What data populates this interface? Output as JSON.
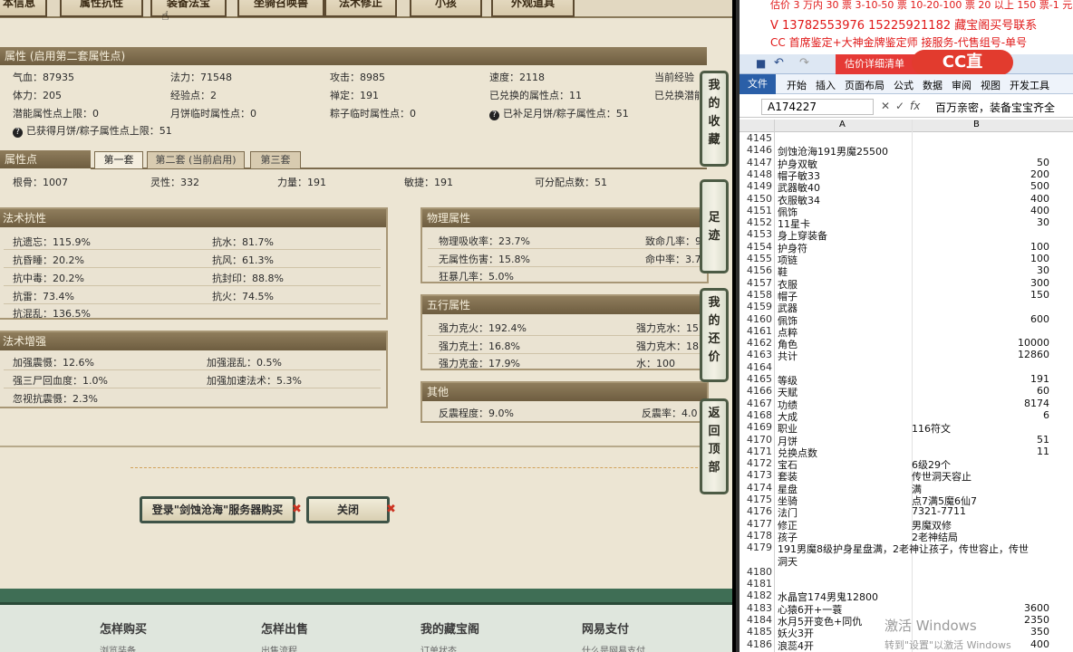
{
  "game": {
    "tabs": [
      "本信息",
      "属性抗性",
      "装备法宝",
      "坐骑召唤兽",
      "法术修正",
      "小孩",
      "外观道具"
    ],
    "attr_section_title": "属性 (启用第二套属性点)",
    "attr_rows": [
      [
        "气血：87935",
        "法力：71548",
        "攻击：8985",
        "速度：2118",
        "当前经验"
      ],
      [
        "体力：205",
        "经验点：2",
        "禅定：191",
        "已兑换的属性点：11",
        "已兑换潜能"
      ],
      [
        "潜能属性点上限：0",
        "月饼临时属性点：0",
        "粽子临时属性点：0",
        "已补足月饼/粽子属性点：51",
        ""
      ],
      [
        "已获得月饼/粽子属性点上限：51",
        "",
        "",
        "",
        ""
      ]
    ],
    "points_title": "属性点",
    "point_tabs": [
      "第一套",
      "第二套 (当前启用)",
      "第三套"
    ],
    "points_row": [
      "根骨：1007",
      "灵性：332",
      "力量：191",
      "敏捷：191",
      "可分配点数：51"
    ],
    "resist_title": "法术抗性",
    "resist_items": [
      [
        "抗遗忘：115.9%",
        "抗水：81.7%"
      ],
      [
        "抗昏睡：20.2%",
        "抗风：61.3%"
      ],
      [
        "抗中毒：20.2%",
        "抗封印：88.8%"
      ],
      [
        "抗雷：73.4%",
        "抗火：74.5%"
      ],
      [
        "抗混乱：136.5%",
        ""
      ]
    ],
    "enhance_title": "法术增强",
    "enhance_items": [
      [
        "加强震慑：12.6%",
        "加强混乱：0.5%"
      ],
      [
        "强三尸回血度：1.0%",
        "加强加速法术：5.3%"
      ],
      [
        "忽视抗震慑：2.3%",
        ""
      ]
    ],
    "phys_title": "物理属性",
    "phys_items": [
      [
        "物理吸收率：23.7%",
        "致命几率：9"
      ],
      [
        "无属性伤害：15.8%",
        "命中率：3.7"
      ],
      [
        "狂暴几率：5.0%",
        ""
      ]
    ],
    "wuxing_title": "五行属性",
    "wuxing_items": [
      [
        "强力克火：192.4%",
        "强力克水：15"
      ],
      [
        "强力克土：16.8%",
        "强力克木：18"
      ],
      [
        "强力克金：17.9%",
        "水：100"
      ]
    ],
    "other_title": "其他",
    "other_items": [
      "反震程度：9.0%",
      "反震率：4.0"
    ],
    "side_tabs": [
      "我的收藏",
      "足迹",
      "我的还价",
      "返回顶部"
    ],
    "buy_button": "登录\"剑蚀沧海\"服务器购买",
    "close_button": "关闭",
    "footer": [
      "怎样购买",
      "怎样出售",
      "我的藏宝阁",
      "网易支付"
    ],
    "footer_sub": [
      "浏览装备",
      "出售流程",
      "订单状态",
      "什么是网易支付"
    ]
  },
  "excel": {
    "ad_lines": [
      "估价 3 万内 30 票  3-10-50 票  10-20-100 票  20 以上 150 票-1 元",
      "V 13782553976   15225921182  藏宝阁买号联系",
      "CC 首席鉴定+大神金牌鉴定师 接服务-代售组号-单号"
    ],
    "window_title": "估价详细清单",
    "logo": "CC直",
    "ribbon_tabs": [
      "文件",
      "开始",
      "插入",
      "页面布局",
      "公式",
      "数据",
      "审阅",
      "视图",
      "开发工具"
    ],
    "name_box": "A174227",
    "formula_symbols": "fx",
    "formula": "百万亲密，装备宝宝齐全",
    "col_a": "A",
    "col_b": "B",
    "rows": [
      [
        "4145",
        "",
        ""
      ],
      [
        "4146",
        "剑蚀沧海191男魔25500",
        ""
      ],
      [
        "4147",
        "护身双敏",
        "50"
      ],
      [
        "4148",
        "帽子敏33",
        "200"
      ],
      [
        "4149",
        "武器敏40",
        "500"
      ],
      [
        "4150",
        "衣服敏34",
        "400"
      ],
      [
        "4151",
        "佩饰",
        "400"
      ],
      [
        "4152",
        "11星卡",
        "30"
      ],
      [
        "4153",
        "身上穿装备",
        ""
      ],
      [
        "4154",
        "护身符",
        "100"
      ],
      [
        "4155",
        "项链",
        "100"
      ],
      [
        "4156",
        "鞋",
        "30"
      ],
      [
        "4157",
        "衣服",
        "300"
      ],
      [
        "4158",
        "帽子",
        "150"
      ],
      [
        "4159",
        "武器",
        ""
      ],
      [
        "4160",
        "佩饰",
        "600"
      ],
      [
        "4161",
        "点粹",
        ""
      ],
      [
        "4162",
        "角色",
        "10000"
      ],
      [
        "4163",
        "共计",
        "12860"
      ],
      [
        "4164",
        "",
        ""
      ],
      [
        "4165",
        "等级",
        "191"
      ],
      [
        "4166",
        "天赋",
        "60"
      ],
      [
        "4167",
        "功绩",
        "8174"
      ],
      [
        "4168",
        "大成",
        "6"
      ],
      [
        "4169",
        "职业",
        "116符文"
      ],
      [
        "4170",
        "月饼",
        "51"
      ],
      [
        "4171",
        "兑换点数",
        "11"
      ],
      [
        "4172",
        "宝石",
        "6级29个"
      ],
      [
        "4173",
        "套装",
        "传世洞天容止"
      ],
      [
        "4174",
        "星盘",
        "满"
      ],
      [
        "4175",
        "坐骑",
        "点7满5魔6仙7"
      ],
      [
        "4176",
        "法门",
        "7321-7711"
      ],
      [
        "4177",
        "修正",
        "男魔双修"
      ],
      [
        "4178",
        "孩子",
        "2老神结局"
      ],
      [
        "4179",
        "191男魔8级护身星盘满，2老神让孩子，传世容止，传世",
        ""
      ],
      [
        "",
        "洞天",
        ""
      ],
      [
        "4180",
        "",
        ""
      ],
      [
        "4181",
        "",
        ""
      ],
      [
        "4182",
        "水晶宫174男鬼12800",
        ""
      ],
      [
        "4183",
        "心猿6开+一蓑",
        "3600"
      ],
      [
        "4184",
        "水月5开变色+同仇",
        "2350"
      ],
      [
        "4185",
        "妖火3开",
        "350"
      ],
      [
        "4186",
        "浪蕊4开",
        "400"
      ],
      [
        "4187",
        "浪蕊4开+封印",
        "500"
      ]
    ],
    "watermark_1": "激活 Windows",
    "watermark_2": "转到\"设置\"以激活 Windows"
  }
}
